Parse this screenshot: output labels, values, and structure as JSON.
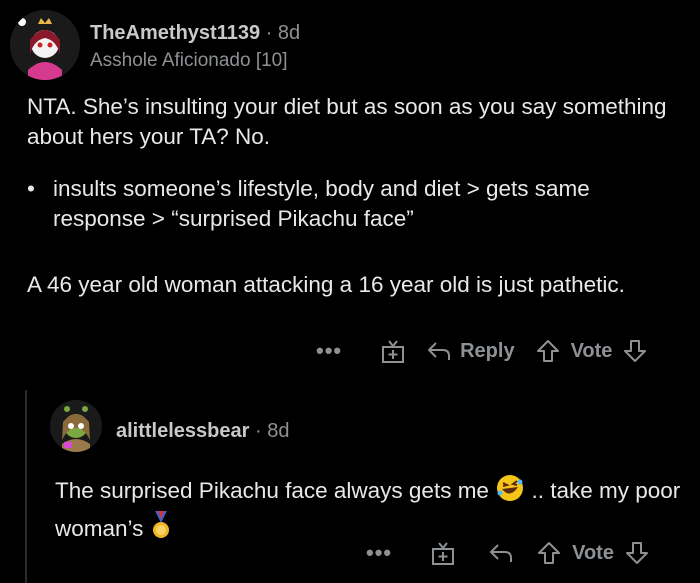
{
  "comment": {
    "username": "TheAmethyst1139",
    "separator": "·",
    "age": "8d",
    "flair": "Asshole Aficionado [10]",
    "paragraph1": "NTA. She’s insulting your diet but as soon as you say something about hers your TA? No.",
    "bullet_marker": "•",
    "bullet_text": "insults someone’s lifestyle, body and diet > gets same response > “surprised Pikachu face”",
    "paragraph2": "A 46 year old woman attacking a 16 year old is just pathetic.",
    "actions": {
      "more": "•••",
      "reply": "Reply",
      "vote": "Vote"
    }
  },
  "reply": {
    "username": "alittlelessbear",
    "separator": "·",
    "age": "8d",
    "text_part1": "The surprised Pikachu face always gets me",
    "text_part2": " .. take my poor woman’s",
    "emoji1": "rofl-emoji",
    "emoji2": "medal-emoji",
    "actions": {
      "more": "•••",
      "vote": "Vote"
    }
  },
  "colors": {
    "background": "#000000",
    "text": "#e8e8e8",
    "muted": "#8e9194"
  }
}
